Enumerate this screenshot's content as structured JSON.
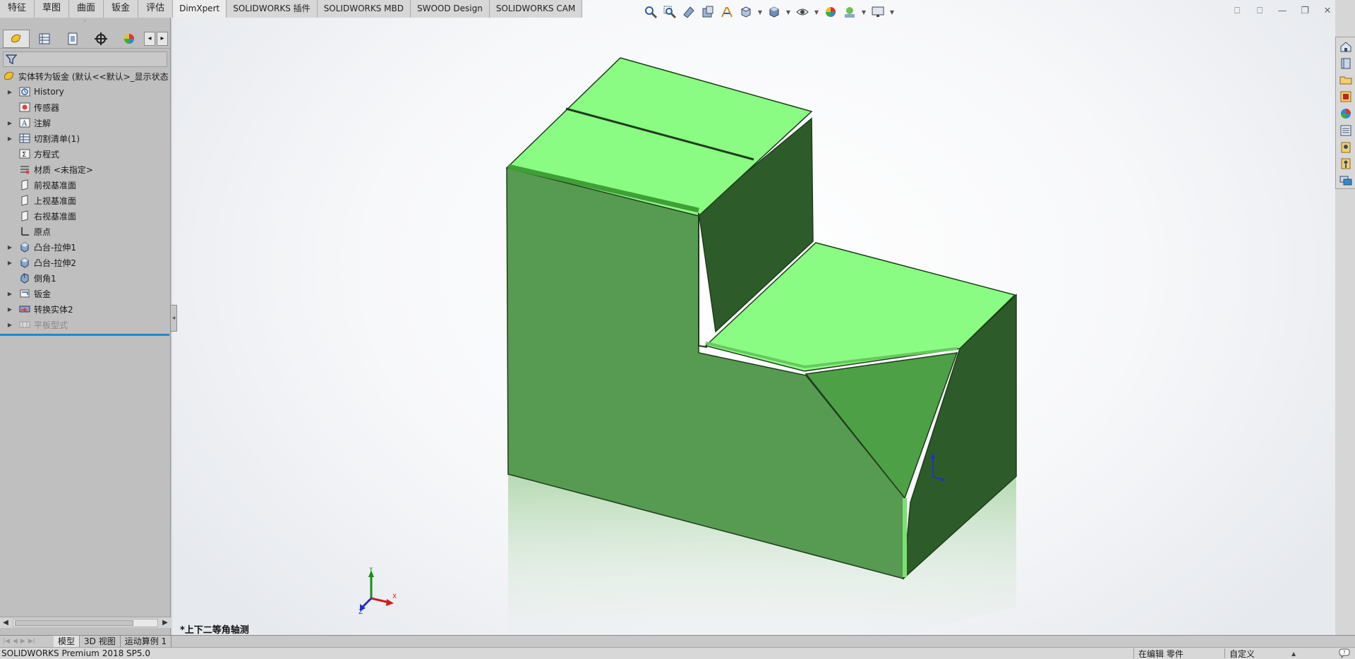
{
  "command_tabs": [
    {
      "label": "特征",
      "active": false
    },
    {
      "label": "草图",
      "active": false
    },
    {
      "label": "曲面",
      "active": false
    },
    {
      "label": "钣金",
      "active": false
    },
    {
      "label": "评估",
      "active": false
    },
    {
      "label": "DimXpert",
      "active": true
    },
    {
      "label": "SOLIDWORKS 插件",
      "active": false
    },
    {
      "label": "SOLIDWORKS MBD",
      "active": false
    },
    {
      "label": "SWOOD Design",
      "active": false
    },
    {
      "label": "SOLIDWORKS CAM",
      "active": false
    }
  ],
  "feature_tree": {
    "root_label": "实体转为钣金  (默认<<默认>_显示状态",
    "items": [
      {
        "label": "History",
        "icon": "history-icon",
        "expandable": true
      },
      {
        "label": "传感器",
        "icon": "sensor-icon",
        "expandable": false
      },
      {
        "label": "注解",
        "icon": "annotation-icon",
        "expandable": true
      },
      {
        "label": "切割清单(1)",
        "icon": "cut-list-icon",
        "expandable": true
      },
      {
        "label": "方程式",
        "icon": "equation-icon",
        "expandable": false
      },
      {
        "label": "材质 <未指定>",
        "icon": "material-icon",
        "expandable": false
      },
      {
        "label": "前视基准面",
        "icon": "plane-icon",
        "expandable": false
      },
      {
        "label": "上视基准面",
        "icon": "plane-icon",
        "expandable": false
      },
      {
        "label": "右视基准面",
        "icon": "plane-icon",
        "expandable": false
      },
      {
        "label": "原点",
        "icon": "origin-icon",
        "expandable": false
      },
      {
        "label": "凸台-拉伸1",
        "icon": "extrude-icon",
        "expandable": true
      },
      {
        "label": "凸台-拉伸2",
        "icon": "extrude-icon",
        "expandable": true
      },
      {
        "label": "倒角1",
        "icon": "chamfer-icon",
        "expandable": false
      },
      {
        "label": "钣金",
        "icon": "sheet-metal-icon",
        "expandable": true
      },
      {
        "label": "转换实体2",
        "icon": "convert-solid-icon",
        "expandable": true
      },
      {
        "label": "平板型式",
        "icon": "flat-pattern-icon",
        "expandable": true,
        "suppressed": true
      }
    ]
  },
  "viewport": {
    "view_label": "*上下二等角轴测",
    "triad": {
      "x": "X",
      "y": "Y",
      "z": "Z"
    }
  },
  "bottom_tabs": [
    {
      "label": "模型",
      "active": true
    },
    {
      "label": "3D 视图",
      "active": false
    },
    {
      "label": "运动算例 1",
      "active": false
    }
  ],
  "status_bar": {
    "product": "SOLIDWORKS Premium 2018 SP5.0",
    "mode": "在编辑 零件",
    "units": "自定义"
  },
  "colors": {
    "face_top": "#8bfc83",
    "face_front": "#579a51",
    "face_side": "#2e5b2a",
    "edge": "#1e3d1b",
    "tree_bg": "#bfbfbf",
    "rollback_bar": "#1b8ad0"
  }
}
